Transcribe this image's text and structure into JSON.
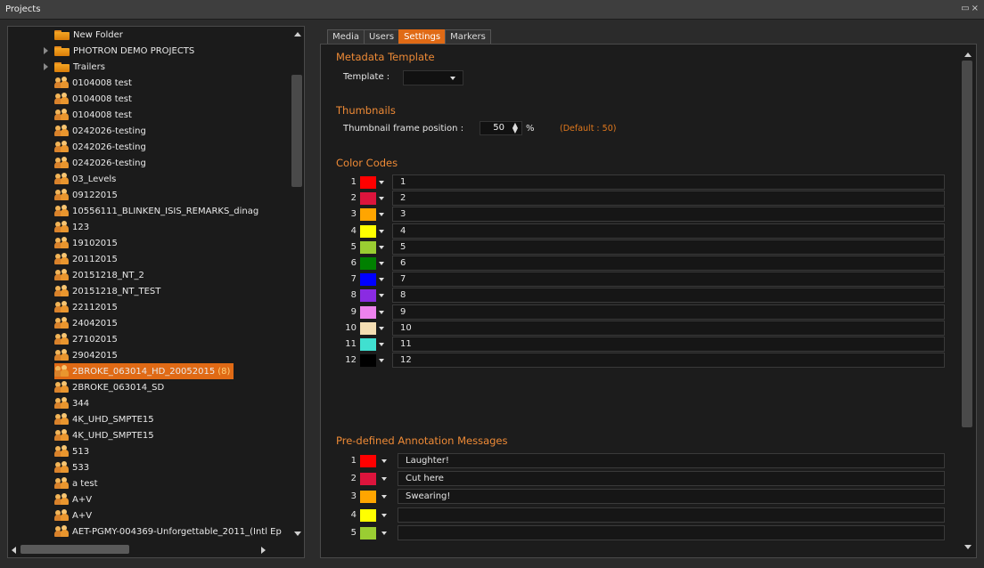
{
  "window": {
    "title": "Projects",
    "controls": [
      "restore-icon",
      "close-icon"
    ],
    "restore_glyph": "▭",
    "close_glyph": "×"
  },
  "tree": {
    "items": [
      {
        "label": "New Folder",
        "kind": "folder",
        "expander": false,
        "indent": 1
      },
      {
        "label": "PHOTRON DEMO PROJECTS",
        "kind": "folder",
        "expander": true,
        "indent": 1
      },
      {
        "label": "Trailers",
        "kind": "folder",
        "expander": true,
        "indent": 1
      },
      {
        "label": "0104008 test",
        "kind": "project",
        "indent": 1
      },
      {
        "label": "0104008 test",
        "kind": "project",
        "indent": 1
      },
      {
        "label": "0104008 test",
        "kind": "project",
        "indent": 1
      },
      {
        "label": "0242026-testing",
        "kind": "project",
        "indent": 1
      },
      {
        "label": "0242026-testing",
        "kind": "project",
        "indent": 1
      },
      {
        "label": "0242026-testing",
        "kind": "project",
        "indent": 1
      },
      {
        "label": "03_Levels",
        "kind": "project",
        "indent": 1
      },
      {
        "label": "09122015",
        "kind": "project",
        "indent": 1
      },
      {
        "label": "10556111_BLINKEN_ISIS_REMARKS_dinag",
        "kind": "project",
        "indent": 1
      },
      {
        "label": "123",
        "kind": "project",
        "indent": 1
      },
      {
        "label": "19102015",
        "kind": "project",
        "indent": 1
      },
      {
        "label": "20112015",
        "kind": "project",
        "indent": 1
      },
      {
        "label": "20151218_NT_2",
        "kind": "project",
        "indent": 1
      },
      {
        "label": "20151218_NT_TEST",
        "kind": "project",
        "indent": 1
      },
      {
        "label": "22112015",
        "kind": "project",
        "indent": 1
      },
      {
        "label": "24042015",
        "kind": "project",
        "indent": 1
      },
      {
        "label": "27102015",
        "kind": "project",
        "indent": 1
      },
      {
        "label": "29042015",
        "kind": "project",
        "indent": 1
      },
      {
        "label": "2BROKE_063014_HD_20052015",
        "kind": "project",
        "indent": 1,
        "selected": true,
        "count": "(8)"
      },
      {
        "label": "2BROKE_063014_SD",
        "kind": "project",
        "indent": 1
      },
      {
        "label": "344",
        "kind": "project",
        "indent": 1
      },
      {
        "label": "4K_UHD_SMPTE15",
        "kind": "project",
        "indent": 1
      },
      {
        "label": "4K_UHD_SMPTE15",
        "kind": "project",
        "indent": 1
      },
      {
        "label": "513",
        "kind": "project",
        "indent": 1
      },
      {
        "label": "533",
        "kind": "project",
        "indent": 1
      },
      {
        "label": "a test",
        "kind": "project",
        "indent": 1
      },
      {
        "label": "A+V",
        "kind": "project",
        "indent": 1
      },
      {
        "label": "A+V",
        "kind": "project",
        "indent": 1
      },
      {
        "label": "AET-PGMY-004369-Unforgettable_2011_(Intl Ep",
        "kind": "project",
        "indent": 1
      }
    ]
  },
  "tabs": [
    {
      "label": "Media",
      "active": false
    },
    {
      "label": "Users",
      "active": false
    },
    {
      "label": "Settings",
      "active": true
    },
    {
      "label": "Markers",
      "active": false
    }
  ],
  "settings": {
    "metadata": {
      "title": "Metadata Template",
      "template_label": "Template :",
      "template_value": ""
    },
    "thumbnails": {
      "title": "Thumbnails",
      "position_label": "Thumbnail frame position :",
      "position_value": "50",
      "unit": "%",
      "default_note": "(Default : 50)"
    },
    "color_codes": {
      "title": "Color Codes",
      "rows": [
        {
          "num": "1",
          "color": "#ff0000",
          "name": "1"
        },
        {
          "num": "2",
          "color": "#dc143c",
          "name": "2"
        },
        {
          "num": "3",
          "color": "#ffa500",
          "name": "3"
        },
        {
          "num": "4",
          "color": "#ffff00",
          "name": "4"
        },
        {
          "num": "5",
          "color": "#9acd32",
          "name": "5"
        },
        {
          "num": "6",
          "color": "#008000",
          "name": "6"
        },
        {
          "num": "7",
          "color": "#0000ff",
          "name": "7"
        },
        {
          "num": "8",
          "color": "#8a2be2",
          "name": "8"
        },
        {
          "num": "9",
          "color": "#ee82ee",
          "name": "9"
        },
        {
          "num": "10",
          "color": "#f5deb3",
          "name": "10"
        },
        {
          "num": "11",
          "color": "#40e0d0",
          "name": "11"
        },
        {
          "num": "12",
          "color": "#000000",
          "name": "12"
        }
      ]
    },
    "annotations": {
      "title": "Pre-defined Annotation Messages",
      "rows": [
        {
          "num": "1",
          "color": "#ff0000",
          "text": "Laughter!"
        },
        {
          "num": "2",
          "color": "#dc143c",
          "text": "Cut here"
        },
        {
          "num": "3",
          "color": "#ffa500",
          "text": "Swearing!"
        },
        {
          "num": "4",
          "color": "#ffff00",
          "text": ""
        },
        {
          "num": "5",
          "color": "#9acd32",
          "text": ""
        }
      ]
    }
  },
  "colors": {
    "accent": "#e06a15",
    "section_title": "#ee8a36"
  }
}
